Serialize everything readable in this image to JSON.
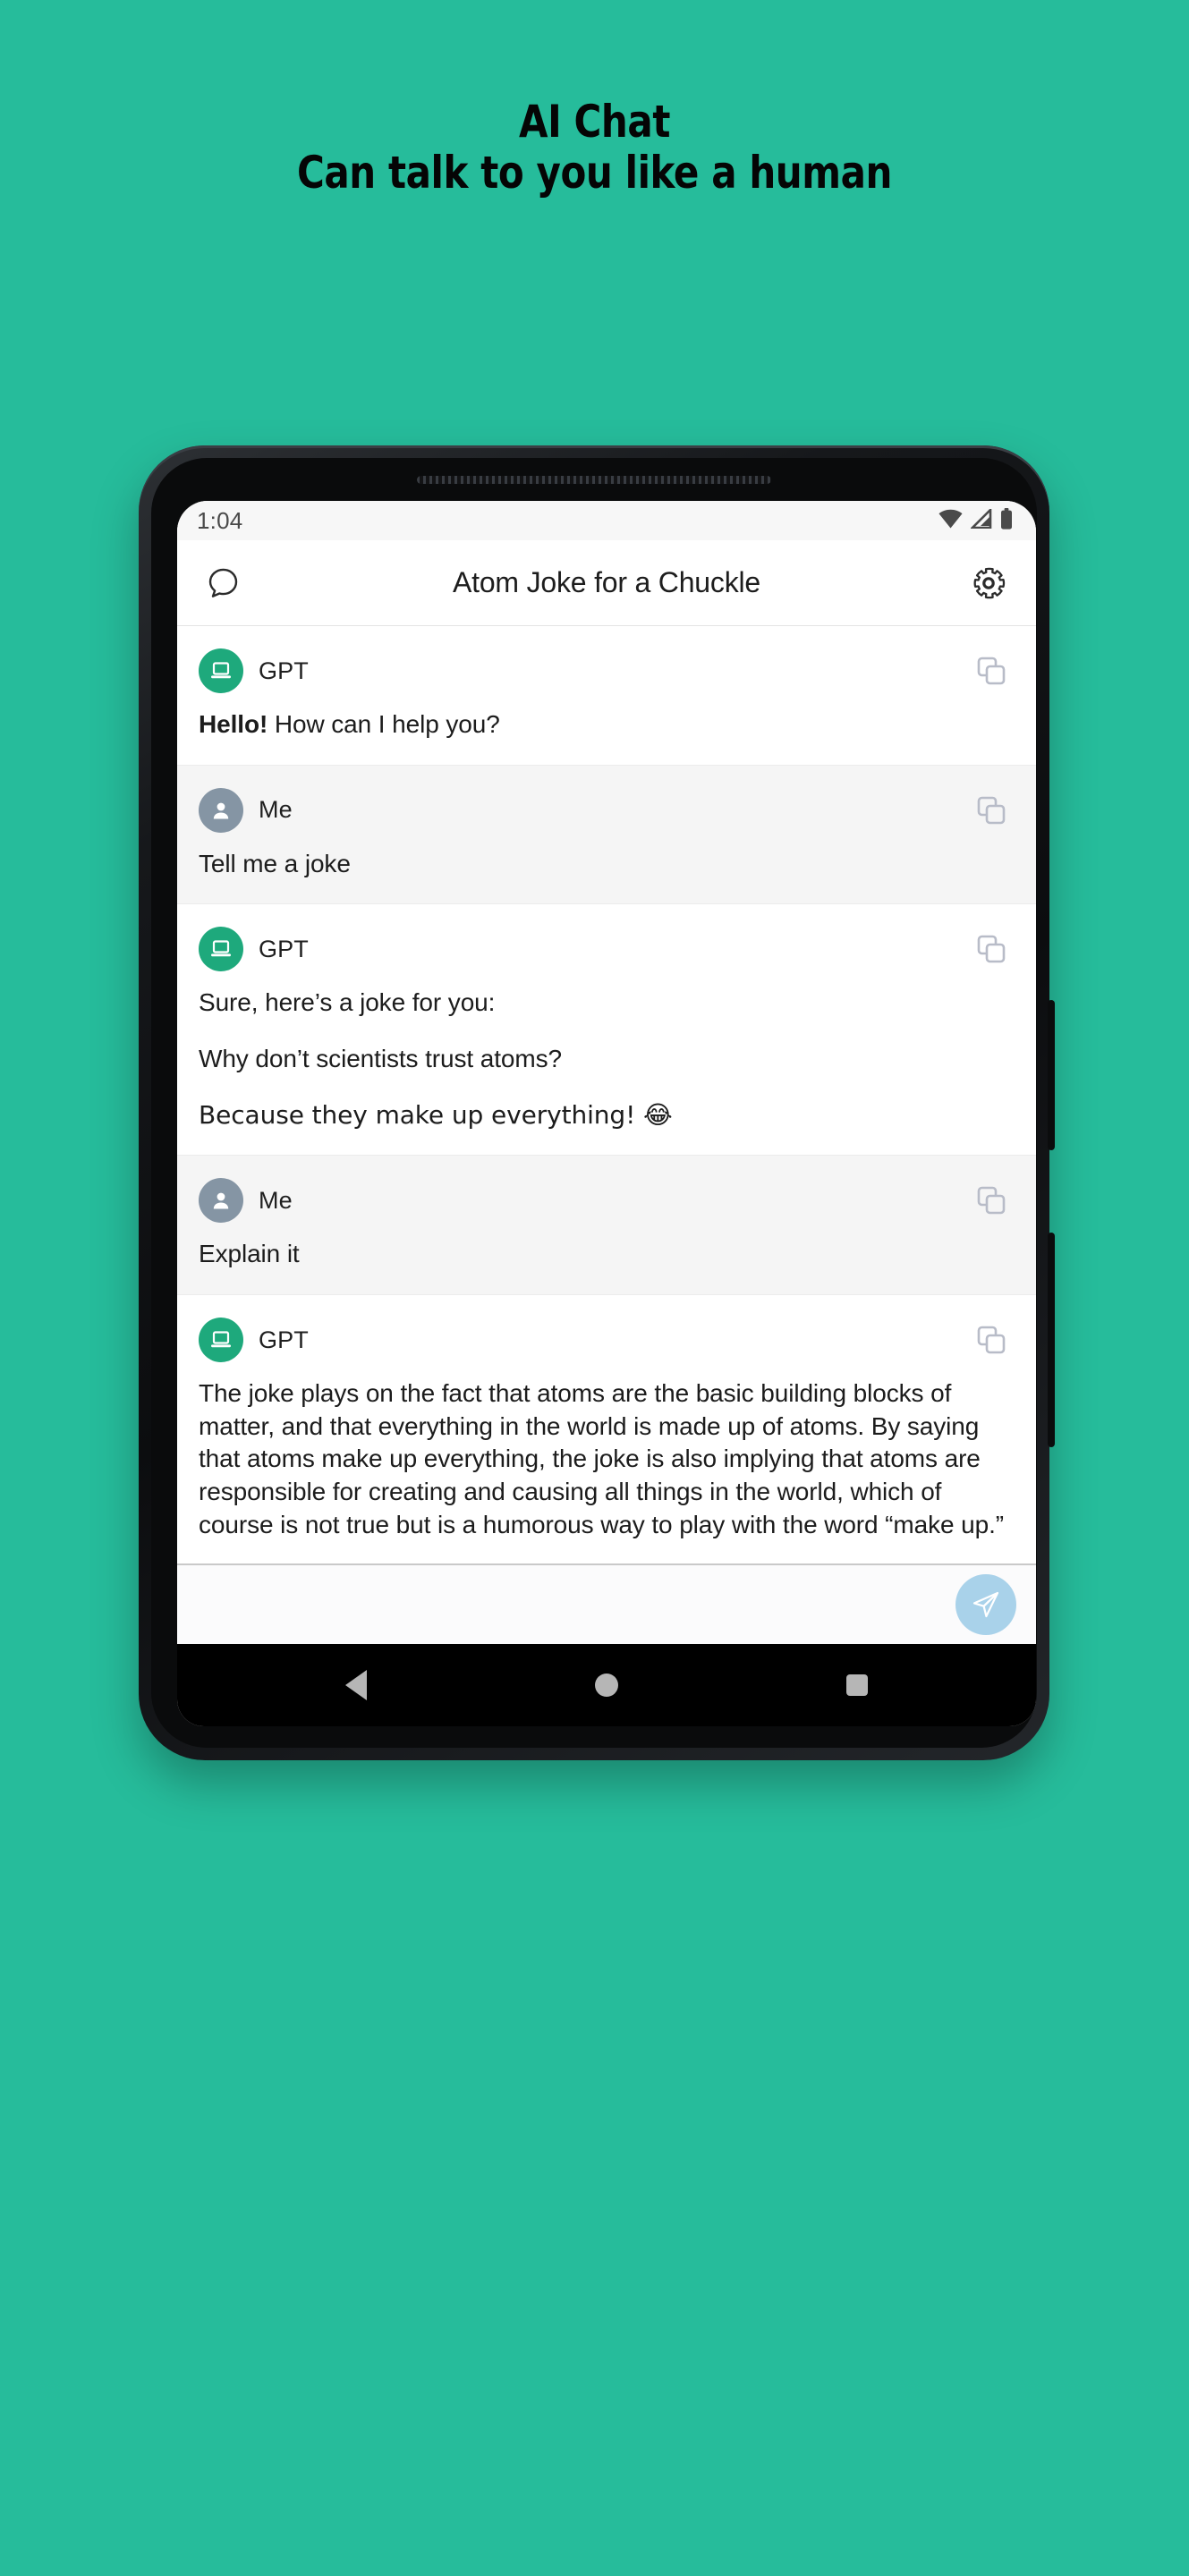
{
  "promo": {
    "line1": "AI Chat",
    "line2": "Can talk to you like a human"
  },
  "colors": {
    "page_background": "#26bc9b",
    "gpt_avatar": "#1ea97c",
    "me_avatar": "#8595a4",
    "send_button": "#a9d2ea",
    "me_row_background": "#f5f5f5",
    "gpt_row_background": "#ffffff",
    "copy_icon": "#b8bcc8"
  },
  "phone": {
    "status_bar": {
      "clock": "1:04",
      "icons": [
        "wifi-icon",
        "cellular-signal-icon",
        "battery-icon"
      ]
    },
    "app_bar": {
      "left_icon": "chat-bubble-icon",
      "title": "Atom Joke for a Chuckle",
      "right_icon": "gear-icon"
    },
    "messages": [
      {
        "role": "gpt",
        "author": "GPT",
        "avatar_icon": "laptop-icon",
        "copy_icon": "copy-icon",
        "paragraphs": [
          {
            "bold_prefix": "Hello!",
            "text": " How can I help you?"
          }
        ]
      },
      {
        "role": "me",
        "author": "Me",
        "avatar_icon": "person-icon",
        "copy_icon": "copy-icon",
        "paragraphs": [
          {
            "bold_prefix": "",
            "text": "Tell me a joke"
          }
        ]
      },
      {
        "role": "gpt",
        "author": "GPT",
        "avatar_icon": "laptop-icon",
        "copy_icon": "copy-icon",
        "paragraphs": [
          {
            "bold_prefix": "",
            "text": "Sure, here’s a joke for you:"
          },
          {
            "bold_prefix": "",
            "text": "Why don’t scientists trust atoms?"
          },
          {
            "bold_prefix": "",
            "text": "Because they make up everything! 😂"
          }
        ]
      },
      {
        "role": "me",
        "author": "Me",
        "avatar_icon": "person-icon",
        "copy_icon": "copy-icon",
        "paragraphs": [
          {
            "bold_prefix": "",
            "text": "Explain it"
          }
        ]
      },
      {
        "role": "gpt",
        "author": "GPT",
        "avatar_icon": "laptop-icon",
        "copy_icon": "copy-icon",
        "paragraphs": [
          {
            "bold_prefix": "",
            "text": "The joke plays on the fact that atoms are the basic building blocks of matter, and that everything in the world is made up of atoms. By saying that atoms make up everything, the joke is also implying that atoms are responsible for creating and causing all things in the world, which of course is not true but is a humorous way to play with the word “make up.”"
          }
        ]
      }
    ],
    "composer": {
      "value": "",
      "placeholder": "",
      "send_icon": "send-paper-plane-icon"
    },
    "nav_bar": {
      "back": "back-triangle-icon",
      "home": "home-circle-icon",
      "recents": "recents-square-icon"
    }
  }
}
